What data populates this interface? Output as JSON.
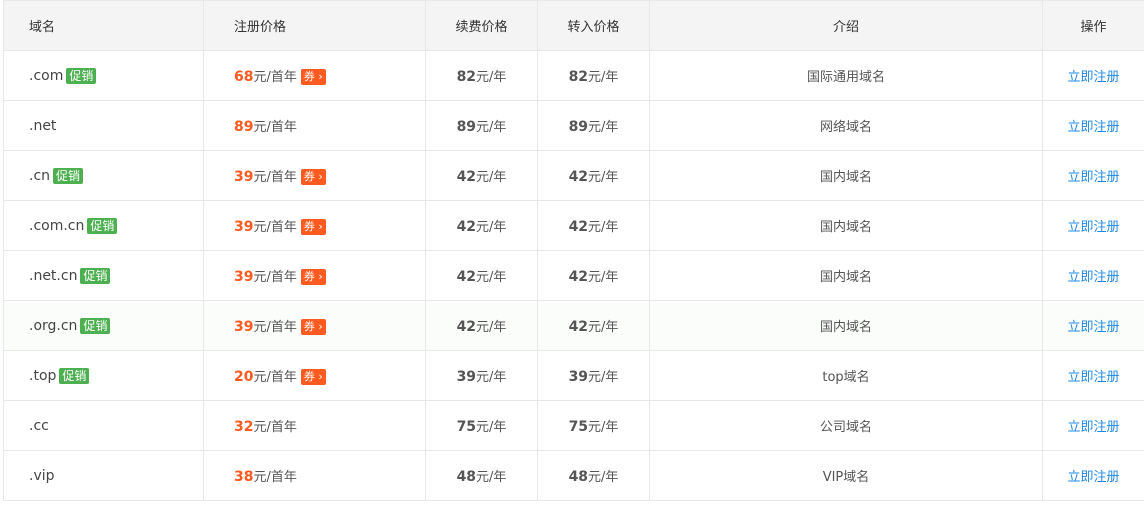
{
  "headers": {
    "name": "域名",
    "register": "注册价格",
    "renew": "续费价格",
    "transfer": "转入价格",
    "desc": "介绍",
    "action": "操作"
  },
  "rows": [
    {
      "name": ".com",
      "promo": "促销",
      "reg": "68",
      "reg_unit": "元/首年",
      "coupon": "券 ›",
      "renew": "82",
      "renew_unit": "元/年",
      "transfer": "82",
      "transfer_unit": "元/年",
      "desc": "国际通用域名",
      "action": "立即注册"
    },
    {
      "name": ".net",
      "promo": "",
      "reg": "89",
      "reg_unit": "元/首年",
      "coupon": "",
      "renew": "89",
      "renew_unit": "元/年",
      "transfer": "89",
      "transfer_unit": "元/年",
      "desc": "网络域名",
      "action": "立即注册"
    },
    {
      "name": ".cn",
      "promo": "促销",
      "reg": "39",
      "reg_unit": "元/首年",
      "coupon": "券 ›",
      "renew": "42",
      "renew_unit": "元/年",
      "transfer": "42",
      "transfer_unit": "元/年",
      "desc": "国内域名",
      "action": "立即注册"
    },
    {
      "name": ".com.cn",
      "promo": "促销",
      "reg": "39",
      "reg_unit": "元/首年",
      "coupon": "券 ›",
      "renew": "42",
      "renew_unit": "元/年",
      "transfer": "42",
      "transfer_unit": "元/年",
      "desc": "国内域名",
      "action": "立即注册"
    },
    {
      "name": ".net.cn",
      "promo": "促销",
      "reg": "39",
      "reg_unit": "元/首年",
      "coupon": "券 ›",
      "renew": "42",
      "renew_unit": "元/年",
      "transfer": "42",
      "transfer_unit": "元/年",
      "desc": "国内域名",
      "action": "立即注册"
    },
    {
      "name": ".org.cn",
      "promo": "促销",
      "reg": "39",
      "reg_unit": "元/首年",
      "coupon": "券 ›",
      "renew": "42",
      "renew_unit": "元/年",
      "transfer": "42",
      "transfer_unit": "元/年",
      "desc": "国内域名",
      "action": "立即注册"
    },
    {
      "name": ".top",
      "promo": "促销",
      "reg": "20",
      "reg_unit": "元/首年",
      "coupon": "券 ›",
      "renew": "39",
      "renew_unit": "元/年",
      "transfer": "39",
      "transfer_unit": "元/年",
      "desc": "top域名",
      "action": "立即注册"
    },
    {
      "name": ".cc",
      "promo": "",
      "reg": "32",
      "reg_unit": "元/首年",
      "coupon": "",
      "renew": "75",
      "renew_unit": "元/年",
      "transfer": "75",
      "transfer_unit": "元/年",
      "desc": "公司域名",
      "action": "立即注册"
    },
    {
      "name": ".vip",
      "promo": "",
      "reg": "38",
      "reg_unit": "元/首年",
      "coupon": "",
      "renew": "48",
      "renew_unit": "元/年",
      "transfer": "48",
      "transfer_unit": "元/年",
      "desc": "VIP域名",
      "action": "立即注册"
    }
  ],
  "colors": {
    "promo_badge": "#4caf50",
    "price_highlight": "#ff5a1f",
    "coupon_badge": "#ff5a1f",
    "link": "#1e88e5",
    "header_bg": "#f4f4f4"
  }
}
